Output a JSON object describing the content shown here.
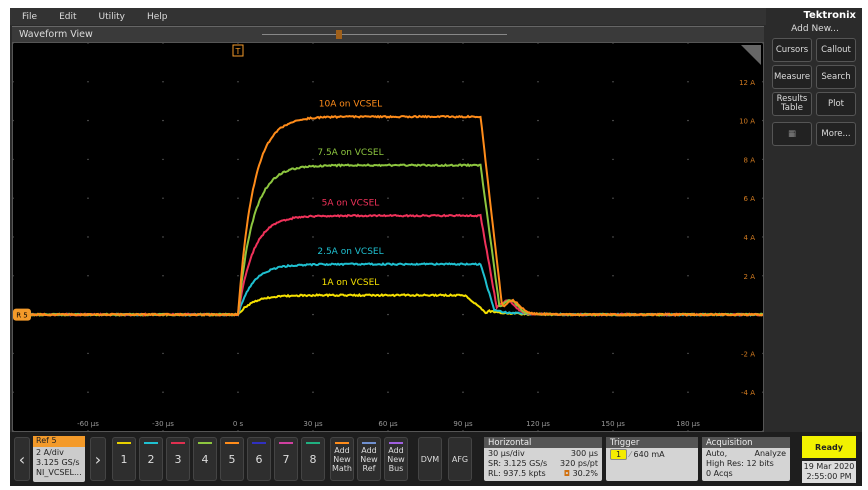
{
  "menu": [
    "File",
    "Edit",
    "Utility",
    "Help"
  ],
  "view_title": "Waveform View",
  "brand": "Tektronix",
  "side": {
    "add_new": "Add New...",
    "buttons": [
      "Cursors",
      "Callout",
      "Measure",
      "Search",
      "Results Table",
      "Plot",
      "More..."
    ]
  },
  "plot": {
    "x_ticks": [
      "-60 µs",
      "-30 µs",
      "0 s",
      "30 µs",
      "60 µs",
      "90 µs",
      "120 µs",
      "150 µs",
      "180 µs"
    ],
    "x_tick_values": [
      -60,
      -30,
      0,
      30,
      60,
      90,
      120,
      150,
      180
    ],
    "y_ticks": [
      "12 A",
      "10 A",
      "8 A",
      "6 A",
      "4 A",
      "2 A",
      "-2 A",
      "-4 A"
    ],
    "y_tick_values": [
      12,
      10,
      8,
      6,
      4,
      2,
      -2,
      -4
    ],
    "xlim": [
      -90,
      210
    ],
    "ylim": [
      -6,
      14
    ],
    "ref_marker": "R 5",
    "trigger_marker": "T",
    "series": [
      {
        "name": "10A on VCSEL",
        "color": "#ff8c1a",
        "level": 10.2,
        "fall_start": 97,
        "fall_end": 106
      },
      {
        "name": "7.5A on VCSEL",
        "color": "#8dc63f",
        "level": 7.7,
        "fall_start": 97,
        "fall_end": 105
      },
      {
        "name": "5A on VCSEL",
        "color": "#f0325a",
        "level": 5.1,
        "fall_start": 97,
        "fall_end": 104
      },
      {
        "name": "2.5A on VCSEL",
        "color": "#1fc0d0",
        "level": 2.6,
        "fall_start": 97,
        "fall_end": 103
      },
      {
        "name": "1A on VCSEL",
        "color": "#f5e000",
        "level": 1.0,
        "fall_start": 91,
        "fall_end": 100
      }
    ]
  },
  "ref": {
    "title": "Ref 5",
    "lines": [
      "2 A/div",
      "3.125 GS/s",
      "NI_VCSEL..."
    ]
  },
  "channels": [
    {
      "label": "1",
      "color": "#e8d000"
    },
    {
      "label": "2",
      "color": "#1fc0d0"
    },
    {
      "label": "3",
      "color": "#e03050"
    },
    {
      "label": "4",
      "color": "#8dc63f"
    },
    {
      "label": "5",
      "color": "#ff8c1a"
    },
    {
      "label": "6",
      "color": "#3030c0"
    },
    {
      "label": "7",
      "color": "#d040a0"
    },
    {
      "label": "8",
      "color": "#20b080"
    }
  ],
  "add_buttons": [
    {
      "label": "Add New Math",
      "color": "#ff8c1a"
    },
    {
      "label": "Add New Ref",
      "color": "#7090d0"
    },
    {
      "label": "Add New Bus",
      "color": "#a060e0"
    }
  ],
  "dvm": "DVM",
  "afg": "AFG",
  "horizontal": {
    "title": "Horizontal",
    "scale": "30 µs/div",
    "duration": "300 µs",
    "sr": "SR: 3.125 GS/s",
    "res": "320 ps/pt",
    "rl": "RL: 937.5 kpts",
    "pos": "30.2%"
  },
  "trigger": {
    "title": "Trigger",
    "source": "1",
    "level": "640 mA"
  },
  "acquisition": {
    "title": "Acquisition",
    "mode": "Auto,",
    "analyze": "Analyze",
    "res": "High Res: 12 bits",
    "acqs": "0 Acqs"
  },
  "status": "Ready",
  "date": "19 Mar 2020",
  "time": "2:55:00 PM"
}
